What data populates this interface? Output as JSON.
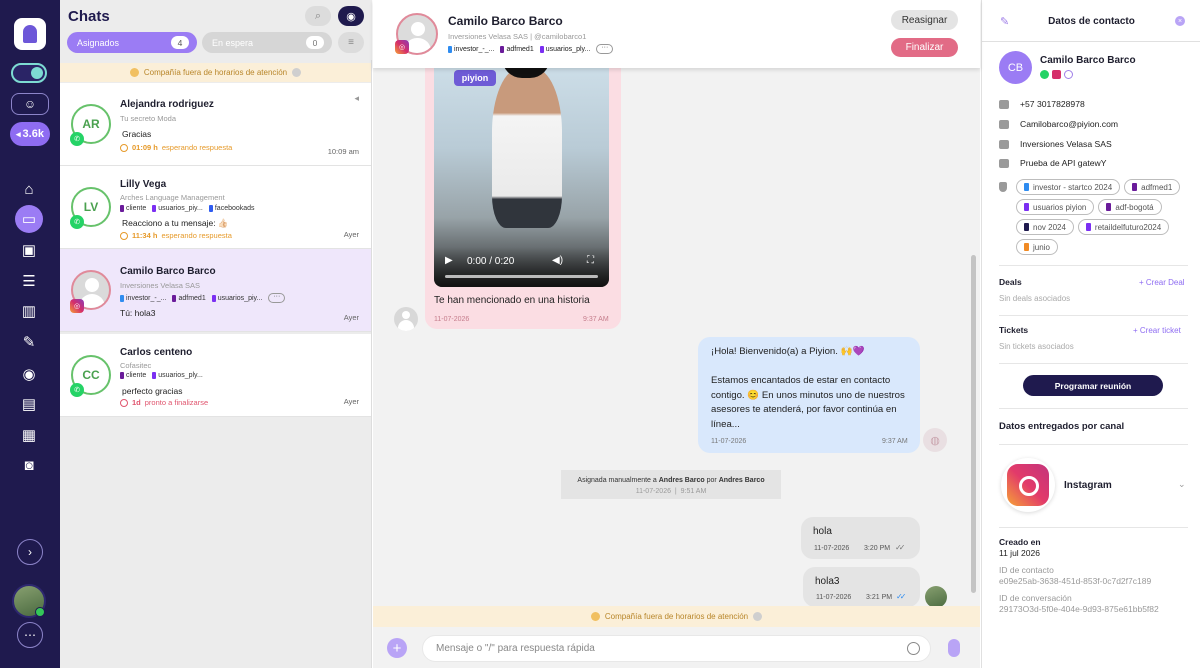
{
  "rail": {
    "badge": "3.6k",
    "icons": [
      "home-icon",
      "chat-icon",
      "contacts-icon",
      "list-icon",
      "stats-icon",
      "campaign-icon",
      "piggy-bank-icon",
      "ticket-icon",
      "calendar-icon",
      "bot-icon"
    ]
  },
  "chat_list": {
    "title": "Chats",
    "tabs": [
      {
        "label": "Asignados",
        "count": "4"
      },
      {
        "label": "En espera",
        "count": "0"
      }
    ],
    "banner": "Compañía fuera de horarios de atención",
    "conversations": [
      {
        "initials": "AR",
        "name": "Alejandra rodriguez",
        "company": "Tu secreto Moda",
        "message": "Gracias",
        "status_time": "01:09 h",
        "status_text": "esperando respuesta",
        "time": "10:09 am",
        "channel": "whatsapp",
        "tags": []
      },
      {
        "initials": "LV",
        "name": "Lilly Vega",
        "company": "Arches Language Management",
        "message": "Reacciono a tu mensaje: 👍🏻",
        "status_time": "11:34 h",
        "status_text": "esperando respuesta",
        "time": "Ayer",
        "channel": "whatsapp",
        "tags": [
          "cliente",
          "usuarios_piy...",
          "facebookads"
        ]
      },
      {
        "initials": "",
        "name": "Camilo Barco Barco",
        "company": "Inversiones Velasa SAS",
        "message": "Tú: hola3",
        "status_time": "",
        "status_text": "",
        "time": "Ayer",
        "channel": "instagram",
        "tags": [
          "investor_-_...",
          "adfmed1",
          "usuarios_piy..."
        ]
      },
      {
        "initials": "CC",
        "name": "Carlos centeno",
        "company": "Cofasitec",
        "message": "perfecto gracias",
        "status_time": "1d",
        "status_text": "pronto a finalizarse",
        "time": "Ayer",
        "channel": "whatsapp",
        "tags": [
          "cliente",
          "usuarios_ply..."
        ]
      }
    ]
  },
  "chat": {
    "contact_name": "Camilo Barco Barco",
    "subtitle": "Inversiones Velasa SAS | @camilobarco1",
    "tags": [
      "investor_-_...",
      "adfmed1",
      "usuarios_ply..."
    ],
    "reassign_label": "Reasignar",
    "finish_label": "Finalizar",
    "story": {
      "video_time": "0:00 / 0:20",
      "sign_text": "piyion",
      "text": "Te han mencionado en una historia",
      "date": "11-07-2026",
      "time": "9:37 AM"
    },
    "bot_message": {
      "text": "¡Hola! Bienvenido(a) a Piyion. 🙌💜\n\nEstamos encantados de estar en contacto contigo. 😊 En unos minutos uno de nuestros asesores te atenderá, por favor continúa en línea...",
      "line1": "¡Hola! Bienvenido(a) a Piyion. 🙌💜",
      "line2": "Estamos encantados de estar en contacto contigo. 😊 En unos minutos uno de nuestros asesores te atenderá, por favor continúa en línea...",
      "date": "11-07-2026",
      "time": "9:37 AM"
    },
    "assignment": {
      "prefix": "Asignada manualmente a",
      "agent": "Andres Barco",
      "by": "por",
      "by_agent": "Andres Barco",
      "date": "11-07-2026",
      "sep": "|",
      "time": "9:51 AM"
    },
    "outgoing": [
      {
        "text": "hola",
        "date": "11-07-2026",
        "time": "3:20 PM",
        "ticks": "✓✓"
      },
      {
        "text": "hola3",
        "date": "11-07-2026",
        "time": "3:21 PM",
        "ticks": "✓✓"
      }
    ],
    "banner": "Compañía fuera de horarios de atención",
    "composer_placeholder": "Mensaje o \"/\" para respuesta rápida"
  },
  "contact": {
    "title": "Datos de contacto",
    "initials": "CB",
    "name": "Camilo Barco Barco",
    "phone": "+57 3017828978",
    "email": "Camilobarco@piyion.com",
    "company": "Inversiones Velasa SAS",
    "note": "Prueba de API gatewY",
    "tags": [
      {
        "label": "investor - startco 2024",
        "color": "#2f8cf0"
      },
      {
        "label": "adfmed1",
        "color": "#6a1b9a"
      },
      {
        "label": "usuarios piyion",
        "color": "#7b2ff2"
      },
      {
        "label": "adf-bogotá",
        "color": "#6a1b9a"
      },
      {
        "label": "nov 2024",
        "color": "#1f1a4e"
      },
      {
        "label": "retaildelfuturo2024",
        "color": "#7b2ff2"
      },
      {
        "label": "junio",
        "color": "#f08a24"
      }
    ],
    "deals_title": "Deals",
    "deals_link": "+ Crear Deal",
    "deals_empty": "Sin deals asociados",
    "tickets_title": "Tickets",
    "tickets_link": "+ Crear ticket",
    "tickets_empty": "Sin tickets asociados",
    "schedule_label": "Programar reunión",
    "channel_section": "Datos entregados por canal",
    "channel_name": "Instagram",
    "created_label": "Creado en",
    "created_value": "11 jul 2026",
    "contact_id_label": "ID de contacto",
    "contact_id": "e09e25ab-3638-451d-853f-0c7d2f7c189",
    "conversation_id_label": "ID de conversación",
    "conversation_id": "29173O3d-5f0e-404e-9d93-875e61bb5f82"
  },
  "colors": {
    "rail": "#1f1a4e",
    "accent": "#8e6cf2",
    "finish": "#e26b86",
    "whatsapp": "#25d366",
    "banner": "#fbefd8"
  }
}
